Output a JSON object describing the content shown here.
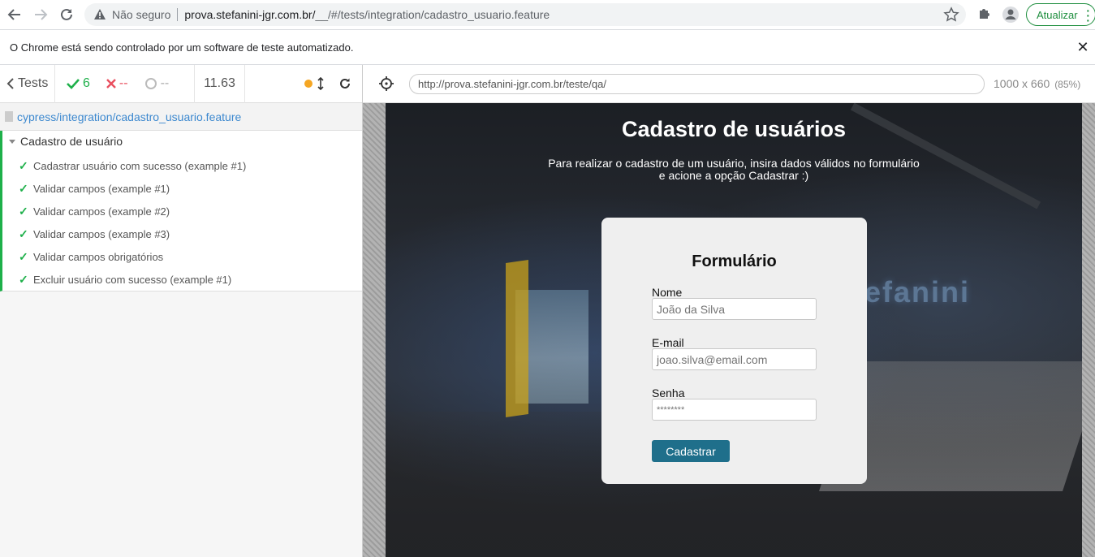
{
  "browser": {
    "omnibox": {
      "security_label": "Não seguro",
      "url_host": "prova.stefanini-jgr.com.br/",
      "url_path": "__/#/tests/integration/cadastro_usuario.feature"
    },
    "update_label": "Atualizar",
    "infobar_text": "O Chrome está sendo controlado por um software de teste automatizado."
  },
  "reporter": {
    "tests_label": "Tests",
    "passed": "6",
    "failed": "--",
    "pending": "--",
    "duration": "11.63",
    "spec_path": "cypress/integration/cadastro_usuario.feature",
    "suite_title": "Cadastro de usuário",
    "tests": [
      "Cadastrar usuário com sucesso (example #1)",
      "Validar campos (example #1)",
      "Validar campos (example #2)",
      "Validar campos (example #3)",
      "Validar campos obrigatórios",
      "Excluir usuário com sucesso (example #1)"
    ]
  },
  "aut": {
    "url": "http://prova.stefanini-jgr.com.br/teste/qa/",
    "viewport": "1000 x 660",
    "scale": "(85%)"
  },
  "page": {
    "title": "Cadastro de usuários",
    "subtitle_line1": "Para realizar o cadastro de um usuário, insira dados válidos no formulário",
    "subtitle_line2": "e acione a opção Cadastrar :)",
    "form": {
      "title": "Formulário",
      "name_label": "Nome",
      "name_placeholder": "João da Silva",
      "email_label": "E-mail",
      "email_placeholder": "joao.silva@email.com",
      "password_label": "Senha",
      "password_placeholder": "********",
      "submit_label": "Cadastrar"
    }
  },
  "colors": {
    "pass": "#1eb04a",
    "fail": "#e94f5f",
    "link": "#3c88cf",
    "submit": "#1f6f8b",
    "chrome_update": "#1e8e3e"
  }
}
